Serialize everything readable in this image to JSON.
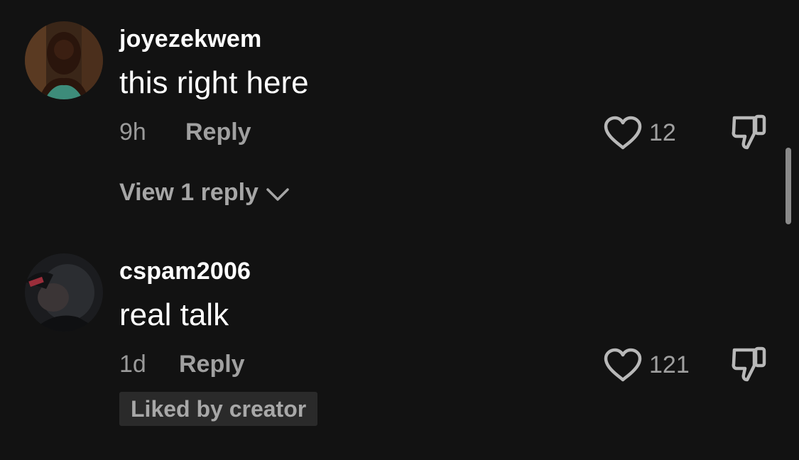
{
  "comments": [
    {
      "username": "joyezekwem",
      "text": "this right here",
      "time": "9h",
      "reply_label": "Reply",
      "likes": "12",
      "view_replies": "View 1 reply"
    },
    {
      "username": "cspam2006",
      "text": "real talk",
      "time": "1d",
      "reply_label": "Reply",
      "likes": "121",
      "badge": "Liked by creator"
    }
  ],
  "icons": {
    "like": "heart-outline-icon",
    "dislike": "thumbs-down-icon",
    "expand": "chevron-down-icon"
  },
  "colors": {
    "background": "#121212",
    "primary_text": "#ffffff",
    "secondary_text": "#a0a0a0",
    "badge_bg": "#2a2a2a"
  }
}
